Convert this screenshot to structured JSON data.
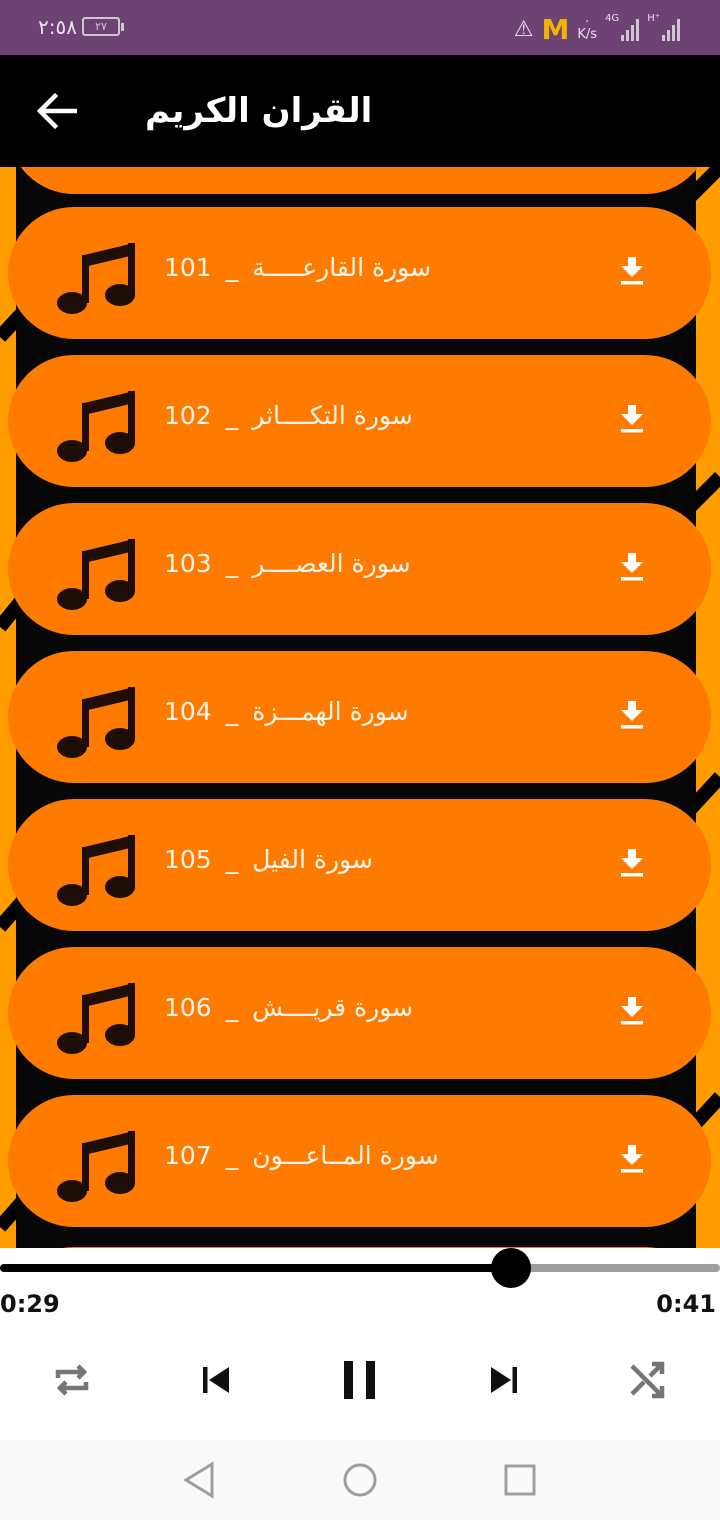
{
  "status_bar": {
    "time": "٢:٥٨",
    "battery": "٢٧",
    "speed_value": "·",
    "speed_unit": "K/s",
    "net1": "4G",
    "net2": "H⁺"
  },
  "app_bar": {
    "title": "القران الكريم",
    "back_icon": "arrow-left-icon"
  },
  "tracks": [
    {
      "num": "101",
      "sep": "_",
      "name": "سورة القارعـــــة"
    },
    {
      "num": "102",
      "sep": "_",
      "name": "سورة التكــــاثر"
    },
    {
      "num": "103",
      "sep": "_",
      "name": "سورة العصــــر"
    },
    {
      "num": "104",
      "sep": "_",
      "name": "سورة الهمـــزة"
    },
    {
      "num": "105",
      "sep": "_",
      "name": "سورة الفيل"
    },
    {
      "num": "106",
      "sep": "_",
      "name": "سورة قريــــش"
    },
    {
      "num": "107",
      "sep": "_",
      "name": "سورة المــاعـــون"
    }
  ],
  "player": {
    "current_time": "0:29",
    "total_time": "0:41",
    "progress": 0.71,
    "controls": [
      "repeat-icon",
      "skip-previous-icon",
      "pause-icon",
      "skip-next-icon",
      "shuffle-icon"
    ]
  },
  "colors": {
    "status_bar": "#6d4373",
    "app_bar": "#000000",
    "track_pill": "#ff7b00",
    "background_accent": "#ff9d00"
  }
}
